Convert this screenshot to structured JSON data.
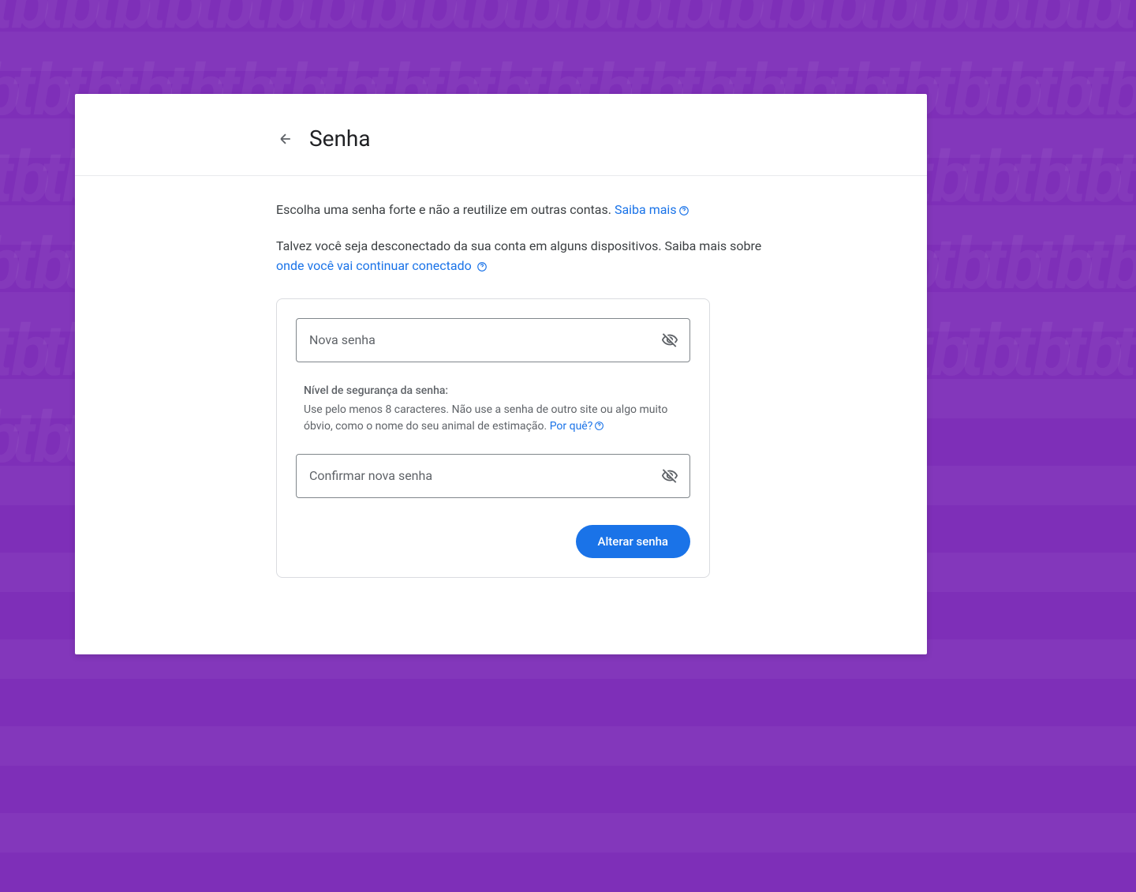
{
  "header": {
    "title": "Senha"
  },
  "intro": {
    "line1_prefix": "Escolha uma senha forte e não a reutilize em outras contas. ",
    "line1_link": "Saiba mais",
    "line2_prefix": "Talvez você seja desconectado da sua conta em alguns dispositivos. Saiba mais sobre ",
    "line2_link": "onde você vai continuar conectado"
  },
  "form": {
    "new_password_placeholder": "Nova senha",
    "confirm_password_placeholder": "Confirmar nova senha",
    "strength_title": "Nível de segurança da senha:",
    "strength_desc_prefix": "Use pelo menos 8 caracteres. Não use a senha de outro site ou algo muito óbvio, como o nome do seu animal de estimação. ",
    "strength_link": "Por quê?",
    "submit_label": "Alterar senha"
  },
  "colors": {
    "background_purple": "#7e2fb8",
    "link_blue": "#1a73e8",
    "button_blue": "#1a73e8",
    "text_primary": "#202124",
    "text_secondary": "#5f6368",
    "border_gray": "#dadce0"
  }
}
